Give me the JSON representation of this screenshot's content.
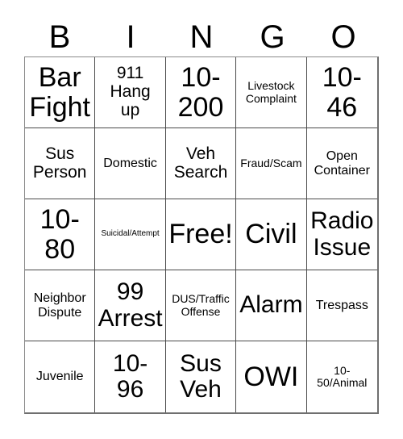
{
  "card": {
    "headers": [
      "B",
      "I",
      "N",
      "G",
      "O"
    ],
    "rows": [
      [
        {
          "text": "Bar\nFight",
          "size": "fs-xl"
        },
        {
          "text": "911\nHang\nup",
          "size": "fs-md"
        },
        {
          "text": "10-\n200",
          "size": "fs-xl"
        },
        {
          "text": "Livestock\nComplaint",
          "size": "fs-xs"
        },
        {
          "text": "10-\n46",
          "size": "fs-xl"
        }
      ],
      [
        {
          "text": "Sus\nPerson",
          "size": "fs-md"
        },
        {
          "text": "Domestic",
          "size": "fs-sm"
        },
        {
          "text": "Veh\nSearch",
          "size": "fs-md"
        },
        {
          "text": "Fraud/Scam",
          "size": "fs-xs"
        },
        {
          "text": "Open\nContainer",
          "size": "fs-sm"
        }
      ],
      [
        {
          "text": "10-\n80",
          "size": "fs-xl"
        },
        {
          "text": "Suicidal/Attempt",
          "size": "fs-xxs"
        },
        {
          "text": "Free!",
          "size": "fs-xl"
        },
        {
          "text": "Civil",
          "size": "fs-xl"
        },
        {
          "text": "Radio\nIssue",
          "size": "fs-lg"
        }
      ],
      [
        {
          "text": "Neighbor\nDispute",
          "size": "fs-sm"
        },
        {
          "text": "99\nArrest",
          "size": "fs-lg"
        },
        {
          "text": "DUS/Traffic\nOffense",
          "size": "fs-xs"
        },
        {
          "text": "Alarm",
          "size": "fs-lg"
        },
        {
          "text": "Trespass",
          "size": "fs-sm"
        }
      ],
      [
        {
          "text": "Juvenile",
          "size": "fs-sm"
        },
        {
          "text": "10-\n96",
          "size": "fs-lg"
        },
        {
          "text": "Sus\nVeh",
          "size": "fs-lg"
        },
        {
          "text": "OWI",
          "size": "fs-xl"
        },
        {
          "text": "10-\n50/Animal",
          "size": "fs-xs"
        }
      ]
    ],
    "colors": {
      "background": "#ffffff",
      "text": "#000000",
      "grid_line": "#4a4a4a",
      "grid_outer": "#6f6f6f"
    }
  }
}
